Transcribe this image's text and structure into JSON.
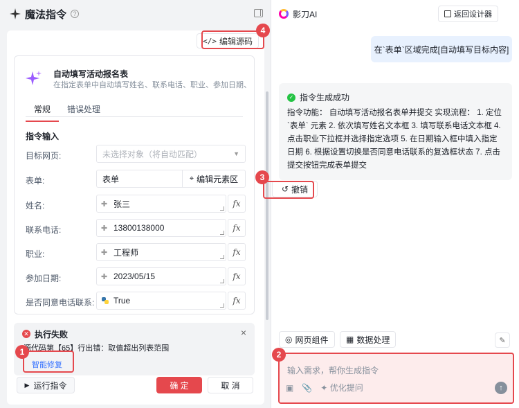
{
  "left": {
    "title": "魔法指令",
    "help": "?",
    "edit_source": "编辑源码",
    "code_glyph": "</>",
    "card": {
      "title": "自动填写活动报名表",
      "desc": "在指定表单中自动填写姓名、联系电话、职业、参加日期、..."
    },
    "tabs": [
      "常规",
      "错误处理"
    ],
    "section": "指令输入",
    "fields": {
      "target_label": "目标网页:",
      "target_value": "未选择对象（将自动匹配）",
      "form_label": "表单:",
      "form_value": "表单",
      "form_edit": "编辑元素区",
      "name_label": "姓名:",
      "name_value": "张三",
      "phone_label": "联系电话:",
      "phone_value": "13800138000",
      "job_label": "职业:",
      "job_value": "工程师",
      "date_label": "参加日期:",
      "date_value": "2023/05/15",
      "agree_label": "是否同意电话联系:",
      "agree_value": "True",
      "fx": "fx"
    },
    "error": {
      "title": "执行失败",
      "message": "源代码第【65】行出错：取值超出列表范围",
      "fix": "智能修复",
      "close": "×"
    },
    "footer": {
      "run": "运行指令",
      "ok": "确 定",
      "cancel": "取 消"
    }
  },
  "right": {
    "app": "影刀AI",
    "back": "返回设计器",
    "user_msg": "在`表单`区域完成[自动填写目标内容]",
    "resp_title": "指令生成成功",
    "resp_body": "指令功能： 自动填写活动报名表单并提交 实现流程： 1. 定位 `表单` 元素 2. 依次填写姓名文本框 3. 填写联系电话文本框 4. 点击职业下拉框并选择指定选项 5. 在日期输入框中填入指定日期 6. 根据设置切换是否同意电话联系的复选框状态 7. 点击提交按钮完成表单提交",
    "undo": "撤销",
    "chips": [
      "网页组件",
      "数据处理"
    ],
    "input_placeholder": "输入需求，帮你生成指令",
    "optimize": "优化提问"
  },
  "badges": [
    "1",
    "2",
    "3",
    "4"
  ],
  "colors": {
    "accent": "#e5484d",
    "link": "#3370ff",
    "success": "#23c343"
  }
}
